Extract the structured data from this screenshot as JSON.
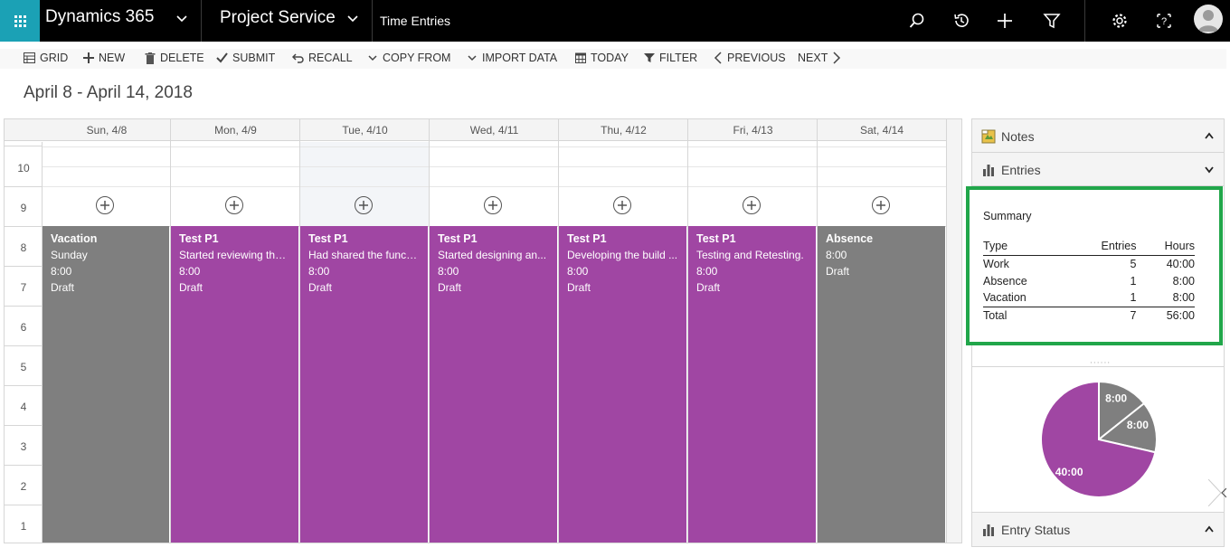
{
  "nav": {
    "brand": "Dynamics 365",
    "app": "Project Service",
    "breadcrumb": "Time Entries",
    "icons": [
      "search-icon",
      "history-icon",
      "add-icon",
      "filter-icon",
      "settings-icon",
      "help-icon",
      "user-avatar-icon"
    ],
    "accent": "#1ba1b5"
  },
  "commands": {
    "grid": "GRID",
    "new": "NEW",
    "delete": "DELETE",
    "submit": "SUBMIT",
    "recall": "RECALL",
    "copy_from": "COPY FROM",
    "import_data": "IMPORT DATA",
    "today": "TODAY",
    "filter": "FILTER",
    "previous": "PREVIOUS",
    "next": "NEXT"
  },
  "period": "April 8 - April 14, 2018",
  "calendar": {
    "days": [
      "Sun, 4/8",
      "Mon, 4/9",
      "Tue, 4/10",
      "Wed, 4/11",
      "Thu, 4/12",
      "Fri, 4/13",
      "Sat, 4/14"
    ],
    "hours": [
      "10",
      "9",
      "8",
      "7",
      "6",
      "5",
      "4",
      "3",
      "2",
      "1"
    ],
    "entries": [
      {
        "title": "Vacation",
        "desc": "Sunday",
        "duration": "8:00",
        "status": "Draft",
        "color": "#7f7f7f"
      },
      {
        "title": "Test P1",
        "desc": "Started reviewing the ...",
        "duration": "8:00",
        "status": "Draft",
        "color": "#a046a3"
      },
      {
        "title": "Test P1",
        "desc": "Had shared the functi...",
        "duration": "8:00",
        "status": "Draft",
        "color": "#a046a3"
      },
      {
        "title": "Test P1",
        "desc": "Started designing an...",
        "duration": "8:00",
        "status": "Draft",
        "color": "#a046a3"
      },
      {
        "title": "Test P1",
        "desc": "Developing the build ...",
        "duration": "8:00",
        "status": "Draft",
        "color": "#a046a3"
      },
      {
        "title": "Test P1",
        "desc": "Testing and Retesting.",
        "duration": "8:00",
        "status": "Draft",
        "color": "#a046a3"
      },
      {
        "title": "Absence",
        "desc": "8:00",
        "duration": "Draft",
        "status": "",
        "color": "#7f7f7f"
      }
    ]
  },
  "panel": {
    "notes": "Notes",
    "entries": "Entries",
    "entry_status": "Entry Status",
    "summary": {
      "title": "Summary",
      "headers": [
        "Type",
        "Entries",
        "Hours"
      ],
      "rows": [
        [
          "Work",
          "5",
          "40:00"
        ],
        [
          "Absence",
          "1",
          "8:00"
        ],
        [
          "Vacation",
          "1",
          "8:00"
        ]
      ],
      "total": [
        "Total",
        "7",
        "56:00"
      ]
    },
    "highlight_color": "#21a64a"
  },
  "chart_data": {
    "type": "pie",
    "labels": [
      "8:00",
      "8:00",
      "40:00"
    ],
    "values": [
      8,
      8,
      40
    ],
    "colors": [
      "#7f7f7f",
      "#7f7f7f",
      "#a046a3"
    ]
  }
}
